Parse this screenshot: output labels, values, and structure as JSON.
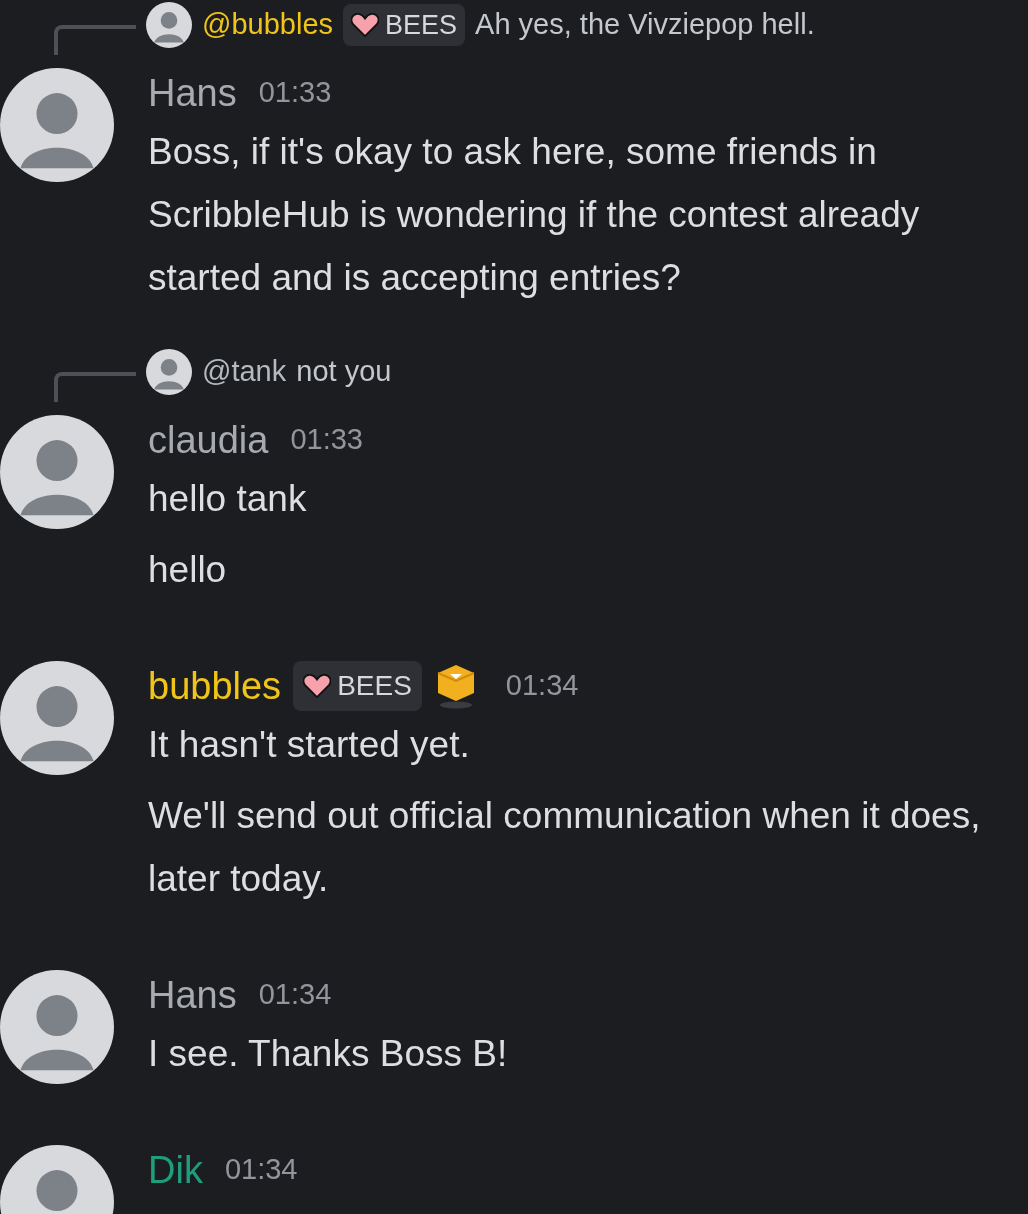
{
  "groups": [
    {
      "reply": {
        "author": "@bubbles",
        "color": "#f0c419",
        "badge": "BEES",
        "text": "Ah yes, the Vivziepop hell."
      },
      "author": "Hans",
      "color": "#a7aaaf",
      "time": "01:33",
      "messages": [
        "Boss, if it's okay to ask here, some friends in ScribbleHub is wondering if the contest already started and is accepting entries?"
      ]
    },
    {
      "reply": {
        "author": "@tank",
        "color": "#b5bac1",
        "text": "not you"
      },
      "author": "claudia",
      "color": "#a7aaaf",
      "time": "01:33",
      "messages": [
        "hello tank",
        "hello"
      ]
    },
    {
      "author": "bubbles",
      "color": "#f0c419",
      "badge": "BEES",
      "box_icon": true,
      "time": "01:34",
      "messages": [
        "It hasn't started yet.",
        "We'll send out official communication when it does, later today."
      ]
    },
    {
      "author": "Hans",
      "color": "#a7aaaf",
      "time": "01:34",
      "messages": [
        "I see.  Thanks Boss B!"
      ]
    },
    {
      "author": "Dik",
      "color": "#1f9e7e",
      "time": "01:34"
    }
  ]
}
